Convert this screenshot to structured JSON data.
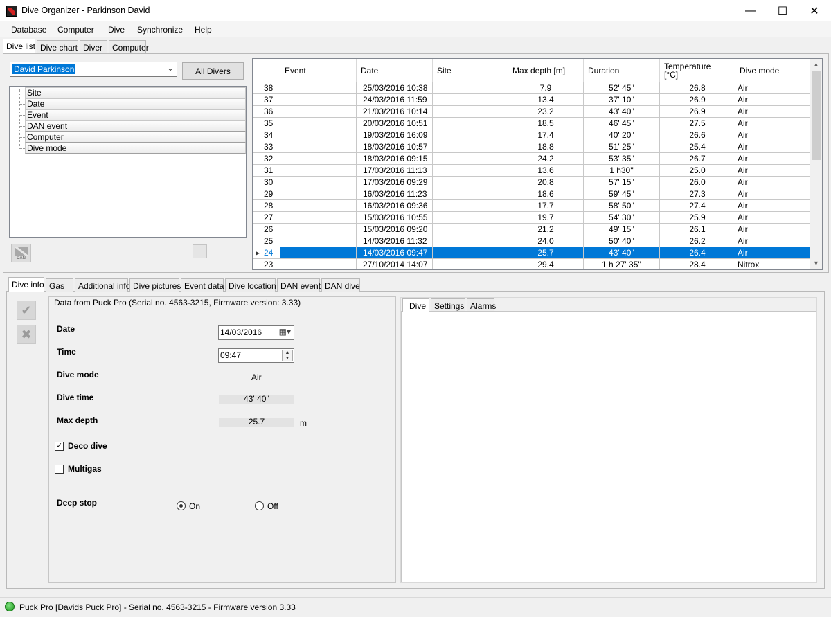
{
  "window": {
    "title": "Dive Organizer - Parkinson David",
    "minimize_icon": "minimize-icon",
    "maximize_icon": "maximize-icon",
    "close_icon": "close-icon"
  },
  "menu": [
    "Database",
    "Computer",
    "Dive",
    "Synchronize",
    "Help"
  ],
  "main_tabs": [
    "Dive list",
    "Dive chart",
    "Diver",
    "Computer"
  ],
  "main_tabs_active": "Dive list",
  "diver_select": {
    "value": "David Parkinson"
  },
  "all_divers_label": "All Divers",
  "group_by": [
    "Site",
    "Date",
    "Event",
    "DAN event",
    "Computer",
    "Dive mode"
  ],
  "dan_button_label": "DAN",
  "small_button_label": "...",
  "grid": {
    "columns": [
      "Event",
      "Date",
      "Site",
      "Max depth [m]",
      "Duration",
      "Temperature\n[°C]",
      "Dive mode"
    ],
    "rows": [
      {
        "id": "38",
        "event": "",
        "date": "25/03/2016 10:38",
        "site": "",
        "depth": "7.9",
        "duration": "52' 45''",
        "temp": "26.8",
        "mode": "Air"
      },
      {
        "id": "37",
        "event": "",
        "date": "24/03/2016 11:59",
        "site": "",
        "depth": "13.4",
        "duration": "37' 10''",
        "temp": "26.9",
        "mode": "Air"
      },
      {
        "id": "36",
        "event": "",
        "date": "21/03/2016 10:14",
        "site": "",
        "depth": "23.2",
        "duration": "43' 40''",
        "temp": "26.9",
        "mode": "Air"
      },
      {
        "id": "35",
        "event": "",
        "date": "20/03/2016 10:51",
        "site": "",
        "depth": "18.5",
        "duration": "46' 45''",
        "temp": "27.5",
        "mode": "Air"
      },
      {
        "id": "34",
        "event": "",
        "date": "19/03/2016 16:09",
        "site": "",
        "depth": "17.4",
        "duration": "40' 20''",
        "temp": "26.6",
        "mode": "Air"
      },
      {
        "id": "33",
        "event": "",
        "date": "18/03/2016 10:57",
        "site": "",
        "depth": "18.8",
        "duration": "51' 25''",
        "temp": "25.4",
        "mode": "Air"
      },
      {
        "id": "32",
        "event": "",
        "date": "18/03/2016 09:15",
        "site": "",
        "depth": "24.2",
        "duration": "53' 35''",
        "temp": "26.7",
        "mode": "Air"
      },
      {
        "id": "31",
        "event": "",
        "date": "17/03/2016 11:13",
        "site": "",
        "depth": "13.6",
        "duration": "1 h30''",
        "temp": "25.0",
        "mode": "Air"
      },
      {
        "id": "30",
        "event": "",
        "date": "17/03/2016 09:29",
        "site": "",
        "depth": "20.8",
        "duration": "57' 15''",
        "temp": "26.0",
        "mode": "Air"
      },
      {
        "id": "29",
        "event": "",
        "date": "16/03/2016 11:23",
        "site": "",
        "depth": "18.6",
        "duration": "59' 45''",
        "temp": "27.3",
        "mode": "Air"
      },
      {
        "id": "28",
        "event": "",
        "date": "16/03/2016 09:36",
        "site": "",
        "depth": "17.7",
        "duration": "58' 50''",
        "temp": "27.4",
        "mode": "Air"
      },
      {
        "id": "27",
        "event": "",
        "date": "15/03/2016 10:55",
        "site": "",
        "depth": "19.7",
        "duration": "54' 30''",
        "temp": "25.9",
        "mode": "Air"
      },
      {
        "id": "26",
        "event": "",
        "date": "15/03/2016 09:20",
        "site": "",
        "depth": "21.2",
        "duration": "49' 15''",
        "temp": "26.1",
        "mode": "Air"
      },
      {
        "id": "25",
        "event": "",
        "date": "14/03/2016 11:32",
        "site": "",
        "depth": "24.0",
        "duration": "50' 40''",
        "temp": "26.2",
        "mode": "Air"
      },
      {
        "id": "24",
        "event": "",
        "date": "14/03/2016 09:47",
        "site": "",
        "depth": "25.7",
        "duration": "43' 40''",
        "temp": "26.4",
        "mode": "Air",
        "selected": true
      },
      {
        "id": "23",
        "event": "",
        "date": "27/10/2014 14:07",
        "site": "",
        "depth": "29.4",
        "duration": "1 h 27' 35''",
        "temp": "28.4",
        "mode": "Nitrox"
      }
    ]
  },
  "detail_tabs": [
    "Dive info",
    "Gas",
    "Additional info",
    "Dive pictures",
    "Event data",
    "Dive location",
    "DAN event",
    "DAN dive"
  ],
  "detail_tabs_active": "Dive info",
  "dive_info": {
    "legend": "Data from Puck Pro (Serial no. 4563-3215, Firmware version: 3.33)",
    "date_label": "Date",
    "date_value": "14/03/2016",
    "time_label": "Time",
    "time_value": "09:47",
    "mode_label": "Dive mode",
    "mode_value": "Air",
    "dive_time_label": "Dive time",
    "dive_time_value": "43' 40''",
    "max_depth_label": "Max depth",
    "max_depth_value": "25.7",
    "max_depth_unit": "m",
    "deco_label": "Deco dive",
    "deco_checked": true,
    "multigas_label": "Multigas",
    "multigas_checked": false,
    "deep_stop_label": "Deep stop",
    "on_label": "On",
    "off_label": "Off",
    "deep_stop_value": "On"
  },
  "right_tabs": [
    "Dive",
    "Settings",
    "Alarms"
  ],
  "right_tabs_active": "Dive",
  "status": "Puck Pro [Davids Puck Pro] - Serial no. 4563-3215 - Firmware version 3.33"
}
